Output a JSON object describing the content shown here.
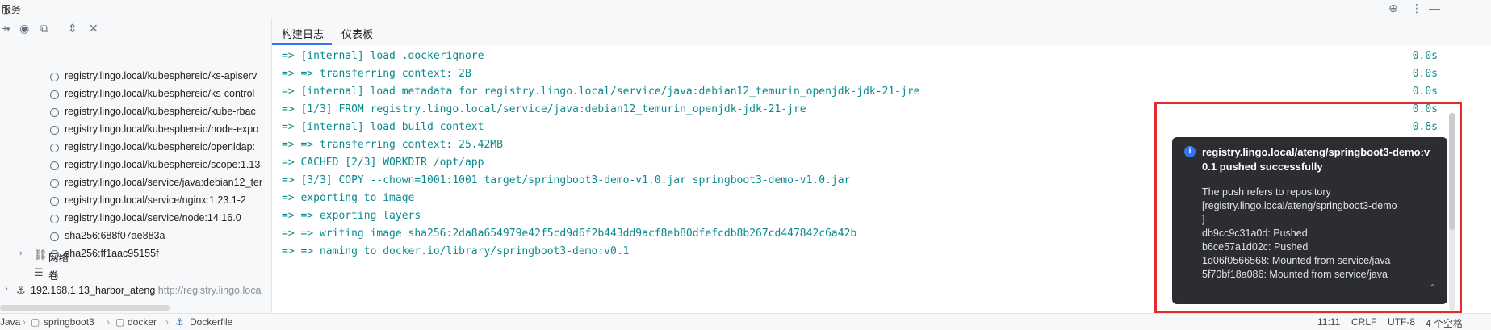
{
  "header": {
    "title": "服务"
  },
  "tabs": [
    {
      "label": "构建日志"
    },
    {
      "label": "仪表板"
    }
  ],
  "tree": {
    "images": [
      {
        "label": "registry.lingo.local/kubesphereio/ks-apiserv"
      },
      {
        "label": "registry.lingo.local/kubesphereio/ks-control"
      },
      {
        "label": "registry.lingo.local/kubesphereio/kube-rbac"
      },
      {
        "label": "registry.lingo.local/kubesphereio/node-expo"
      },
      {
        "label": "registry.lingo.local/kubesphereio/openldap:"
      },
      {
        "label": "registry.lingo.local/kubesphereio/scope:1.13"
      },
      {
        "label": "registry.lingo.local/service/java:debian12_ter"
      },
      {
        "label": "registry.lingo.local/service/nginx:1.23.1-2"
      },
      {
        "label": "registry.lingo.local/service/node:14.16.0"
      },
      {
        "label": "sha256:688f07ae883a"
      },
      {
        "label": "sha256:ff1aac95155f"
      }
    ],
    "network_label": "网络",
    "volume_label": "卷",
    "host_label": "192.168.1.13_harbor_ateng",
    "host_url": "http://registry.lingo.loca"
  },
  "log": [
    {
      "text": "=> [internal] load .dockerignore",
      "time": "0.0s"
    },
    {
      "text": "=> => transferring context: 2B",
      "time": "0.0s"
    },
    {
      "text": "=> [internal] load metadata for registry.lingo.local/service/java:debian12_temurin_openjdk-jdk-21-jre",
      "time": "0.0s"
    },
    {
      "text": "=> [1/3] FROM registry.lingo.local/service/java:debian12_temurin_openjdk-jdk-21-jre",
      "time": "0.0s"
    },
    {
      "text": "=> [internal] load build context",
      "time": "0.8s"
    },
    {
      "text": "=> => transferring context: 25.42MB",
      "time": ""
    },
    {
      "text": "=> CACHED [2/3] WORKDIR /opt/app",
      "time": ""
    },
    {
      "text": "=> [3/3] COPY --chown=1001:1001 target/springboot3-demo-v1.0.jar springboot3-demo-v1.0.jar",
      "time": ""
    },
    {
      "text": "=> exporting to image",
      "time": ""
    },
    {
      "text": "=> => exporting layers",
      "time": ""
    },
    {
      "text": "=> => writing image sha256:2da8a654979e42f5cd9d6f2b443dd9acf8eb80dfefcdb8b267cd447842c6a42b",
      "time": ""
    },
    {
      "text": "=> => naming to docker.io/library/springboot3-demo:v0.1",
      "time": ""
    }
  ],
  "notification": {
    "title": "registry.lingo.local/ateng/springboot3-demo:v0.1 pushed successfully",
    "lines": [
      "The push refers to repository",
      "[registry.lingo.local/ateng/springboot3-demo",
      "]",
      "db9cc9c31a0d: Pushed",
      "b6ce57a1d02c: Pushed",
      "1d06f0566568: Mounted from service/java",
      "5f70bf18a086: Mounted from service/java"
    ]
  },
  "statusbar": {
    "breadcrumbs": [
      "Java",
      "springboot3",
      "docker",
      "Dockerfile"
    ],
    "position": "11:11",
    "line_ending": "CRLF",
    "encoding": "UTF-8",
    "indent": "4 个空格"
  },
  "colors": {
    "accent": "#3574f0",
    "log_text": "#0a8a8e",
    "highlight": "#e52c2c",
    "notification_bg": "#2b2d30"
  }
}
